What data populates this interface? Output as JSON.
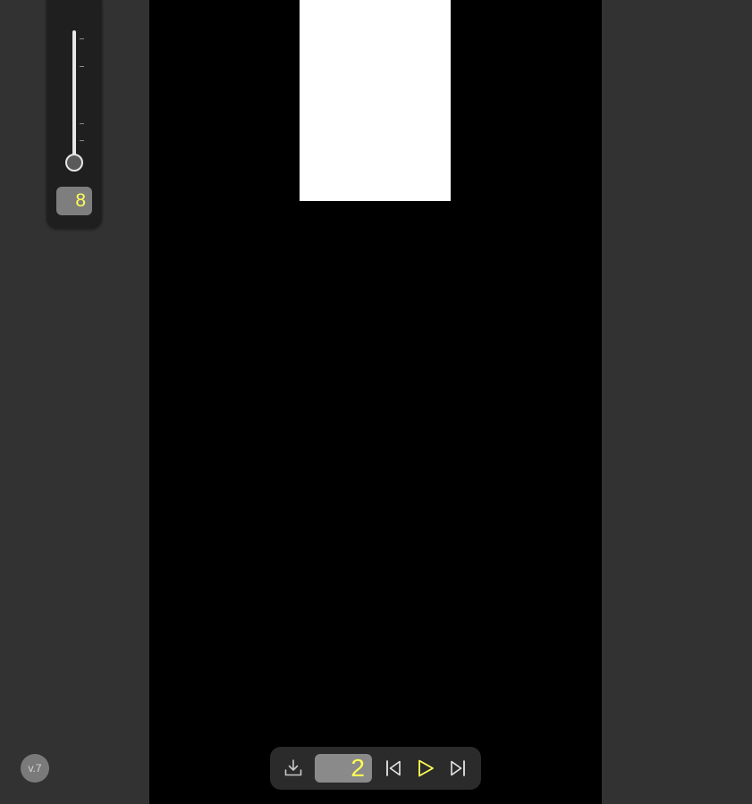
{
  "slider": {
    "value": "8",
    "level": 0.0
  },
  "version": {
    "label": "v.7"
  },
  "toolbar": {
    "frame_number": "2",
    "download_icon": "download-icon",
    "skip_back_icon": "skip-back-icon",
    "play_icon": "play-icon",
    "skip_forward_icon": "skip-forward-icon"
  },
  "colors": {
    "background": "#323232",
    "stage": "#000000",
    "canvas": "#ffffff",
    "accent": "#ffff55",
    "panel": "#1f1f1f"
  }
}
